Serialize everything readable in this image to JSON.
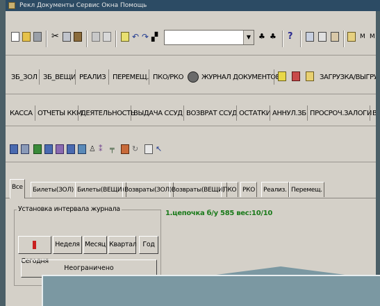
{
  "window": {
    "title_menu": "Рекл  Документы  Сервис  Окна  Помощь"
  },
  "toolbar_icons": [
    "new-icon",
    "open-icon",
    "save-icon",
    "cut-icon",
    "copy-icon",
    "paste-icon",
    "print-icon",
    "preview-icon",
    "form-icon",
    "undo-icon",
    "redo-icon",
    "binoculars-icon",
    "find-next-icon",
    "find-prev-icon",
    "help-icon",
    "calc-icon",
    "grid-icon",
    "report-icon",
    "flag-icon",
    "m-icon",
    "m2-icon"
  ],
  "toolbar2": {
    "items": [
      "ЗБ_ЗОЛ",
      "ЗБ_ВЕЩИ",
      "РЕАЛИЗ",
      "ПЕРЕМЕЩ.",
      "ПКО/РКО",
      "ЖУРНАЛ ДОКУМЕНТОВ",
      "ЗАГРУЗКА/ВЫГРУЗ"
    ]
  },
  "toolbar3": {
    "items": [
      "КАССА",
      "ОТЧЕТЫ ККМ",
      "ДЕЯТЕЛЬНОСТЬ",
      "ВЫДАЧА ССУД",
      "ВОЗВРАТ ССУД",
      "ОСТАТКИ",
      "АННУЛ.ЗБ",
      "ПРОСРОЧ.ЗАЛОГИ",
      "В"
    ]
  },
  "tabs": [
    "Все",
    "Билеты(ЗОЛ)",
    "Билеты(ВЕЩИ)",
    "Возвраты(ЗОЛ)",
    "Возвраты(ВЕЩИ)",
    "ПКО",
    "РКО",
    "Реализ.",
    "Перемещ."
  ],
  "interval_group": {
    "legend": "Установка интервала журнала",
    "buttons": [
      "Сегодня",
      "Неделя",
      "Месяц",
      "Квартал",
      "Год"
    ],
    "wide_button": "Неограничено"
  },
  "status_chain": "1.цепочка б/у 585 вес:10/10",
  "colors": {
    "chain_text": "#1a7a1a",
    "overlay": "#7b98a2",
    "frame": "#4b5f67"
  }
}
